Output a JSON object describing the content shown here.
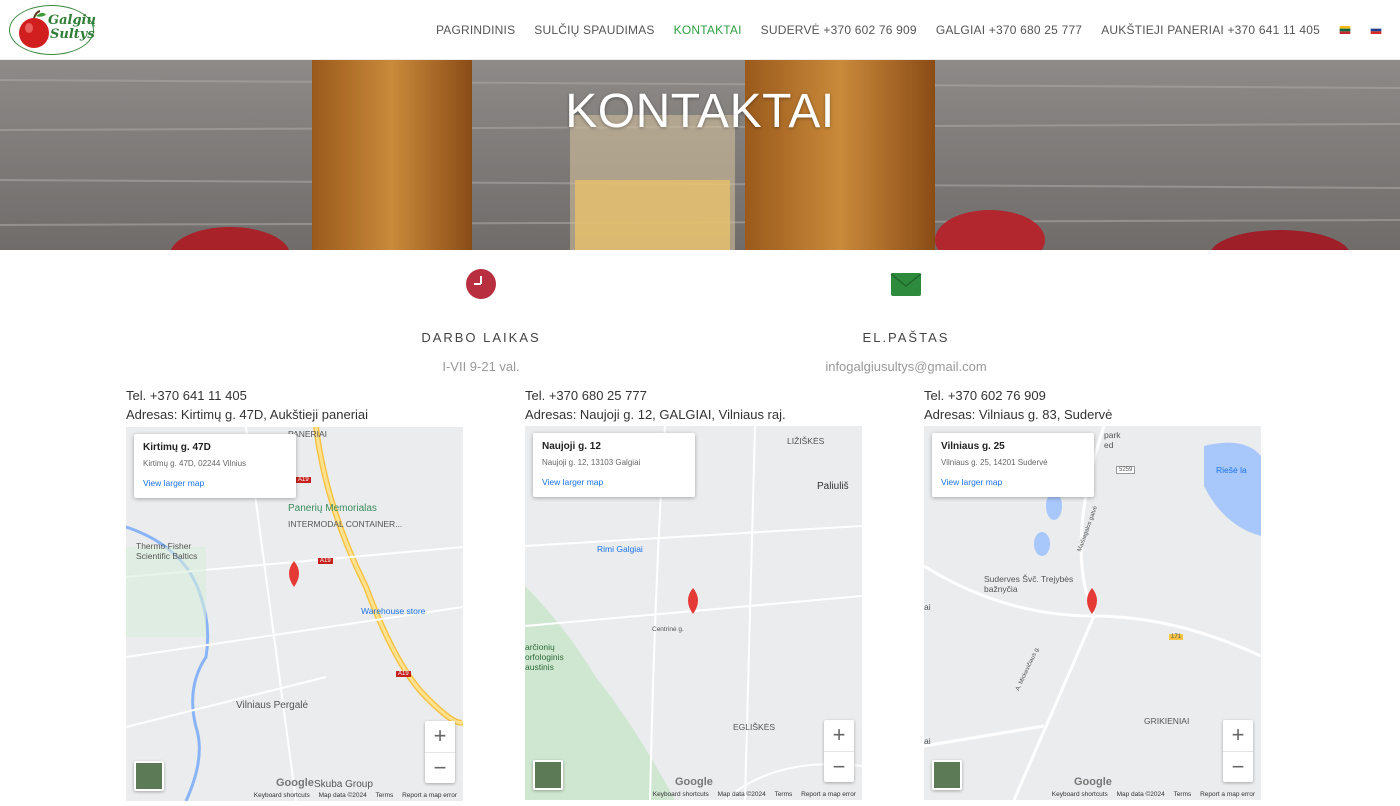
{
  "brand": {
    "logo_line1": "Galgių",
    "logo_line2": "Sultys"
  },
  "nav": {
    "items": [
      {
        "label": "PAGRINDINIS"
      },
      {
        "label": "SULČIŲ SPAUDIMAS"
      },
      {
        "label": "KONTAKTAI"
      },
      {
        "label": "SUDERVĖ +370 602 76 909"
      },
      {
        "label": "GALGIAI +370 680 25 777"
      },
      {
        "label": "AUKŠTIEJI PANERIAI +370 641 11 405"
      }
    ],
    "active_index": 2,
    "active_color": "#2ea043",
    "flags": [
      "flag-lithuania-icon",
      "flag-russia-icon"
    ]
  },
  "hero": {
    "title": "KONTAKTAI"
  },
  "info": [
    {
      "icon": "clock-icon",
      "icon_color": "#b8303f",
      "title": "DARBO LAIKAS",
      "value": "I-VII 9-21 val."
    },
    {
      "icon": "envelope-icon",
      "icon_color": "#2e8b3e",
      "title": "EL.PAŠTAS",
      "value": "infogalgiusultys@gmail.com"
    }
  ],
  "locations": [
    {
      "tel": "Tel. +370 641 11 405",
      "address": "Adresas: Kirtimų g. 47D, Aukštieji paneriai",
      "map": {
        "card_title": "Kirtimų g. 47D",
        "card_sub": "Kirtimų g. 47D, 02244 Vilnius",
        "card_link": "View larger map",
        "labels": [
          "PANERIAI",
          "Panerių Memorialas",
          "INTERMODAL CONTAINER...",
          "Thermo Fisher Scientific Baltics",
          "Warehouse store",
          "Vilniaus Pergalė",
          "Skuba Group",
          "A19",
          "A19",
          "A19"
        ]
      }
    },
    {
      "tel": "Tel. +370 680 25 777",
      "address": "Adresas: Naujoji g. 12, GALGIAI, Vilniaus raj.",
      "map": {
        "card_title": "Naujoji g. 12",
        "card_sub": "Naujoji g. 12, 13103 Galgiai",
        "card_link": "View larger map",
        "labels": [
          "LIŽIŠKĖS",
          "Paliuliš",
          "Rimi Galgiai",
          "Centrinė g.",
          "arčionių orfologinis austinis",
          "EGLIŠKĖS"
        ]
      }
    },
    {
      "tel": "Tel. +370 602 76 909",
      "address": "Adresas: Vilniaus g. 83, Sudervė",
      "map": {
        "card_title": "Vilniaus g. 25",
        "card_sub": "Vilniaus g. 25, 14201 Sudervė",
        "card_link": "View larger map",
        "labels": [
          "park",
          "ed",
          "Riešė la",
          "5259",
          "Suderves Švč. Trejybės bažnyčia",
          "Maišiagalos gatvė",
          "A. Mickevičiaus g.",
          "171",
          "GRIKIENIAI",
          "ai",
          "ai"
        ]
      }
    }
  ],
  "map_ui": {
    "zoom_in": "+",
    "zoom_out": "−",
    "google": "Google",
    "footer": [
      "Keyboard shortcuts",
      "Map data ©2024",
      "Terms",
      "Report a map error"
    ]
  }
}
